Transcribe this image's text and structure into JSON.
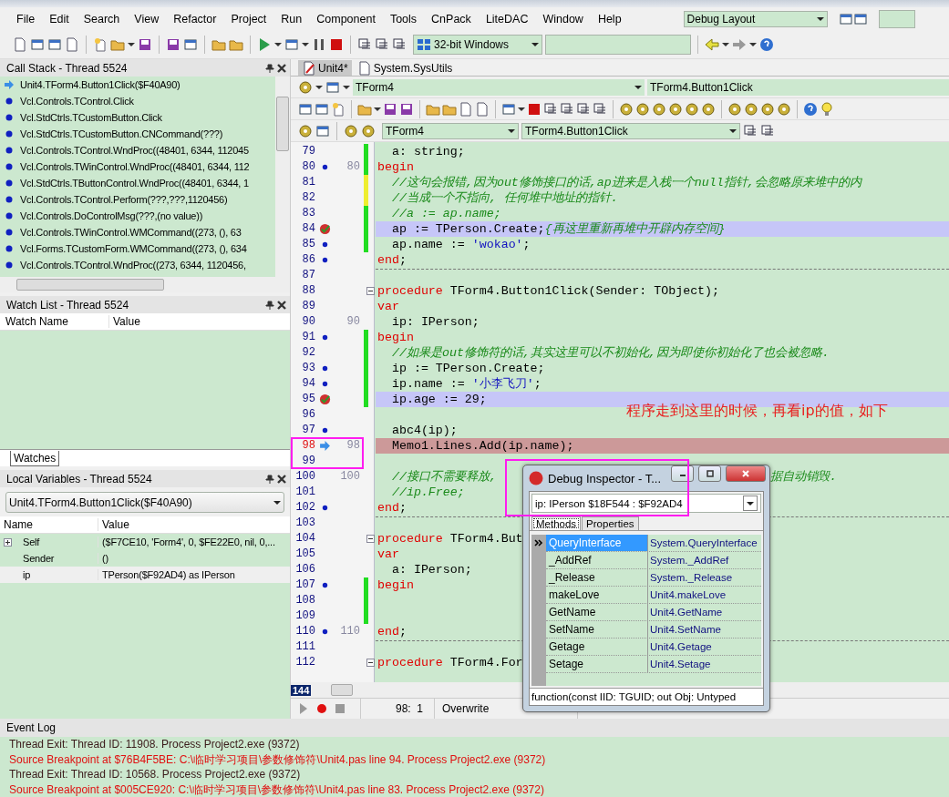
{
  "menu": [
    "File",
    "Edit",
    "Search",
    "View",
    "Refactor",
    "Project",
    "Run",
    "Component",
    "Tools",
    "CnPack",
    "LiteDAC",
    "Window",
    "Help"
  ],
  "layout_combo": "Debug Layout",
  "platform_combo": "32-bit Windows",
  "call_stack": {
    "title": "Call Stack - Thread 5524",
    "frames": [
      {
        "kind": "current",
        "text": "Unit4.TForm4.Button1Click($F40A90)"
      },
      {
        "kind": "frame",
        "text": "Vcl.Controls.TControl.Click"
      },
      {
        "kind": "frame",
        "text": "Vcl.StdCtrls.TCustomButton.Click"
      },
      {
        "kind": "frame",
        "text": "Vcl.StdCtrls.TCustomButton.CNCommand(???)"
      },
      {
        "kind": "frame",
        "text": "Vcl.Controls.TControl.WndProc((48401, 6344, 112045"
      },
      {
        "kind": "frame",
        "text": "Vcl.Controls.TWinControl.WndProc((48401, 6344, 112"
      },
      {
        "kind": "frame",
        "text": "Vcl.StdCtrls.TButtonControl.WndProc((48401, 6344, 1"
      },
      {
        "kind": "frame",
        "text": "Vcl.Controls.TControl.Perform(???,???,1120456)"
      },
      {
        "kind": "frame",
        "text": "Vcl.Controls.DoControlMsg(???,(no value))"
      },
      {
        "kind": "frame",
        "text": "Vcl.Controls.TWinControl.WMCommand((273, (), 63"
      },
      {
        "kind": "frame",
        "text": "Vcl.Forms.TCustomForm.WMCommand((273, (), 634"
      },
      {
        "kind": "frame",
        "text": "Vcl.Controls.TControl.WndProc((273, 6344, 1120456,"
      }
    ]
  },
  "watch_list": {
    "title": "Watch List - Thread 5524",
    "columns": [
      "Watch Name",
      "Value"
    ],
    "tabs": [
      {
        "label": "Watches",
        "selected": true
      }
    ]
  },
  "local_variables": {
    "title": "Local Variables - Thread 5524",
    "frame_combo": "Unit4.TForm4.Button1Click($F40A90)",
    "columns": [
      "Name",
      "Value"
    ],
    "rows": [
      {
        "name": "Self",
        "value": "($F7CE10, 'Form4', 0, $FE22E0, nil, 0,...",
        "expandable": true,
        "selected": false
      },
      {
        "name": "Sender",
        "value": "()",
        "expandable": false,
        "selected": false
      },
      {
        "name": "ip",
        "value": "TPerson($F92AD4) as IPerson",
        "expandable": false,
        "selected": true
      }
    ]
  },
  "editor": {
    "tabs": [
      {
        "label": "Unit4*",
        "selected": true
      },
      {
        "label": "System.SysUtils",
        "selected": false
      }
    ],
    "class_combo": "TForm4",
    "method_combo": "TForm4.Button1Click",
    "class_combo_2": "TForm4",
    "method_combo_2": "TForm4.Button1Click",
    "lines": [
      {
        "number": "79",
        "kind": "plain",
        "changed": true,
        "unsaved": false,
        "tokens": [
          {
            "kind": "plain",
            "text": "  a: string;"
          }
        ]
      },
      {
        "number": "80",
        "kind": "dot",
        "label": "80",
        "changed": true,
        "unsaved": false,
        "tokens": [
          {
            "kind": "kw",
            "text": "begin"
          }
        ]
      },
      {
        "number": "81",
        "kind": "plain",
        "changed": true,
        "unsaved": true,
        "tokens": [
          {
            "kind": "comment",
            "text": "  //这句会报错,因为out修饰接口的话,ap进来是入栈一个null指针,会忽略原来堆中的内"
          }
        ]
      },
      {
        "number": "82",
        "kind": "plain",
        "changed": true,
        "unsaved": true,
        "tokens": [
          {
            "kind": "comment",
            "text": "  //当成一个不指向, 任何堆中地址的指针."
          }
        ]
      },
      {
        "number": "83",
        "kind": "plain",
        "changed": true,
        "unsaved": false,
        "tokens": [
          {
            "kind": "comment",
            "text": "  //a := ap.name;"
          }
        ]
      },
      {
        "number": "84",
        "kind": "breakpoint",
        "changed": true,
        "unsaved": false,
        "tokens": [
          {
            "kind": "plain",
            "text": "  ap := TPerson.Create;"
          },
          {
            "kind": "comment",
            "text": "{再这里重新再堆中开辟内存空间}"
          }
        ]
      },
      {
        "number": "85",
        "kind": "dot",
        "changed": true,
        "unsaved": false,
        "tokens": [
          {
            "kind": "plain",
            "text": "  ap.name := "
          },
          {
            "kind": "string",
            "text": "'wokao'"
          },
          {
            "kind": "plain",
            "text": ";"
          }
        ]
      },
      {
        "number": "86",
        "kind": "dot",
        "changed": false,
        "tokens": [
          {
            "kind": "kw",
            "text": "end"
          },
          {
            "kind": "plain",
            "text": ";"
          }
        ]
      },
      {
        "number": "87",
        "kind": "plain",
        "changed": false,
        "divider": true
      },
      {
        "number": "88",
        "kind": "plain",
        "changed": false,
        "fold": true,
        "tokens": [
          {
            "kind": "kw",
            "text": "procedure"
          },
          {
            "kind": "plain",
            "text": " TForm4.Button1Click(Sender: TObject);"
          }
        ]
      },
      {
        "number": "89",
        "kind": "plain",
        "changed": false,
        "tokens": [
          {
            "kind": "kw",
            "text": "var"
          }
        ]
      },
      {
        "number": "90",
        "kind": "plain",
        "label": "90",
        "changed": false,
        "tokens": [
          {
            "kind": "plain",
            "text": "  ip: IPerson;"
          }
        ]
      },
      {
        "number": "91",
        "kind": "dot",
        "changed": true,
        "unsaved": false,
        "tokens": [
          {
            "kind": "kw",
            "text": "begin"
          }
        ]
      },
      {
        "number": "92",
        "kind": "plain",
        "changed": true,
        "unsaved": false,
        "tokens": [
          {
            "kind": "comment",
            "text": "  //如果是out修饰符的话,其实这里可以不初始化,因为即使你初始化了也会被忽略."
          }
        ]
      },
      {
        "number": "93",
        "kind": "dot",
        "changed": true,
        "unsaved": false,
        "tokens": [
          {
            "kind": "plain",
            "text": "  ip := TPerson.Create;"
          }
        ]
      },
      {
        "number": "94",
        "kind": "dot",
        "changed": true,
        "unsaved": false,
        "tokens": [
          {
            "kind": "plain",
            "text": "  ip.name := "
          },
          {
            "kind": "string",
            "text": "'小李飞刀'"
          },
          {
            "kind": "plain",
            "text": ";"
          }
        ]
      },
      {
        "number": "95",
        "kind": "breakpoint",
        "changed": true,
        "unsaved": false,
        "tokens": [
          {
            "kind": "plain",
            "text": "  ip.age := 29;"
          }
        ]
      },
      {
        "number": "96",
        "kind": "plain",
        "changed": false
      },
      {
        "number": "97",
        "kind": "dot",
        "changed": false,
        "tokens": [
          {
            "kind": "plain",
            "text": "  abc4(ip);"
          }
        ]
      },
      {
        "number": "98",
        "kind": "exec",
        "label": "98",
        "changed": false,
        "tokens": [
          {
            "kind": "plain",
            "text": "  Memo1.Lines.Add(ip.name);"
          }
        ]
      },
      {
        "number": "99",
        "kind": "plain",
        "changed": false
      },
      {
        "number": "100",
        "kind": "plain",
        "label": "100",
        "changed": false,
        "tokens": [
          {
            "kind": "comment",
            "text": "  //接口不需要释放,"
          }
        ],
        "tail": "据自动销毁."
      },
      {
        "number": "101",
        "kind": "plain",
        "changed": false,
        "tokens": [
          {
            "kind": "comment",
            "text": "  //ip.Free;"
          }
        ]
      },
      {
        "number": "102",
        "kind": "dot",
        "changed": false,
        "tokens": [
          {
            "kind": "kw",
            "text": "end"
          },
          {
            "kind": "plain",
            "text": ";"
          }
        ]
      },
      {
        "number": "103",
        "kind": "plain",
        "changed": false,
        "divider": true
      },
      {
        "number": "104",
        "kind": "plain",
        "changed": false,
        "fold": true,
        "tokens": [
          {
            "kind": "kw",
            "text": "procedure"
          },
          {
            "kind": "plain",
            "text": " TForm4.But"
          }
        ]
      },
      {
        "number": "105",
        "kind": "plain",
        "changed": false,
        "tokens": [
          {
            "kind": "kw",
            "text": "var"
          }
        ]
      },
      {
        "number": "106",
        "kind": "plain",
        "changed": false,
        "tokens": [
          {
            "kind": "plain",
            "text": "  a: IPerson;"
          }
        ]
      },
      {
        "number": "107",
        "kind": "dot",
        "changed": true,
        "unsaved": false,
        "tokens": [
          {
            "kind": "kw",
            "text": "begin"
          }
        ]
      },
      {
        "number": "108",
        "kind": "plain",
        "changed": true,
        "unsaved": false
      },
      {
        "number": "109",
        "kind": "plain",
        "changed": true,
        "unsaved": false
      },
      {
        "number": "110",
        "kind": "dot",
        "label": "110",
        "changed": false,
        "tokens": [
          {
            "kind": "kw",
            "text": "end"
          },
          {
            "kind": "plain",
            "text": ";"
          }
        ]
      },
      {
        "number": "111",
        "kind": "plain",
        "changed": false,
        "divider": true
      },
      {
        "number": "112",
        "kind": "plain",
        "changed": false,
        "fold": true,
        "tokens": [
          {
            "kind": "kw",
            "text": "procedure"
          },
          {
            "kind": "plain",
            "text": " TForm4.For"
          }
        ]
      }
    ],
    "line_count": "144",
    "annotation": "程序走到这里的时候，再看ip的值，如下"
  },
  "status_bar": {
    "position": "98:  1",
    "mode": "Overwrite"
  },
  "debug_inspector": {
    "title": "Debug Inspector - T...",
    "expression": "ip: IPerson $18F544 : $F92AD4",
    "tabs": [
      {
        "label": "Methods",
        "selected": true
      },
      {
        "label": "Properties",
        "selected": false
      }
    ],
    "rows": [
      {
        "name": "QueryInterface",
        "value": "System.QueryInterface",
        "selected": true
      },
      {
        "name": "_AddRef",
        "value": "System._AddRef",
        "selected": false
      },
      {
        "name": "_Release",
        "value": "System._Release",
        "selected": false
      },
      {
        "name": "makeLove",
        "value": "Unit4.makeLove",
        "selected": false
      },
      {
        "name": "GetName",
        "value": "Unit4.GetName",
        "selected": false
      },
      {
        "name": "SetName",
        "value": "Unit4.SetName",
        "selected": false
      },
      {
        "name": "Getage",
        "value": "Unit4.Getage",
        "selected": false
      },
      {
        "name": "Setage",
        "value": "Unit4.Setage",
        "selected": false
      }
    ],
    "hint": "function(const IID: TGUID; out Obj: Untyped"
  },
  "event_log": {
    "title": "Event Log",
    "entries": [
      {
        "kind": "thread",
        "text": "Thread Exit: Thread ID: 11908. Process Project2.exe (9372)"
      },
      {
        "kind": "breakpoint",
        "text": "Source Breakpoint at $76B4F5BE: C:\\临时学习项目\\参数修饰符\\Unit4.pas line 94. Process Project2.exe (9372)"
      },
      {
        "kind": "thread",
        "text": "Thread Exit: Thread ID: 10568. Process Project2.exe (9372)"
      },
      {
        "kind": "breakpoint",
        "text": "Source Breakpoint at $005CE920: C:\\临时学习项目\\参数修饰符\\Unit4.pas line 83. Process Project2.exe (9372)"
      }
    ]
  }
}
